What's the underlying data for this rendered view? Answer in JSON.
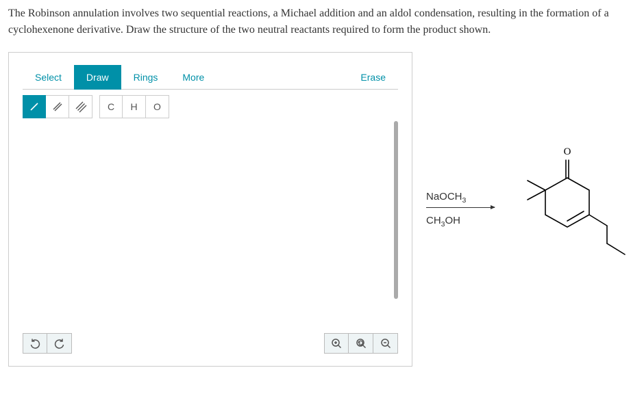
{
  "question": "The Robinson annulation involves two sequential reactions, a Michael addition and an aldol condensation, resulting in the formation of a cyclohexenone derivative. Draw the structure of the two neutral reactants required to form the product shown.",
  "tabs": {
    "select": "Select",
    "draw": "Draw",
    "rings": "Rings",
    "more": "More",
    "erase": "Erase"
  },
  "tools": {
    "single": "/",
    "double": "//",
    "triple": "///",
    "carbon": "C",
    "hydrogen": "H",
    "oxygen": "O"
  },
  "reagents": {
    "top": "NaOCH₃",
    "bottom": "CH₃OH"
  },
  "product_label": "O"
}
